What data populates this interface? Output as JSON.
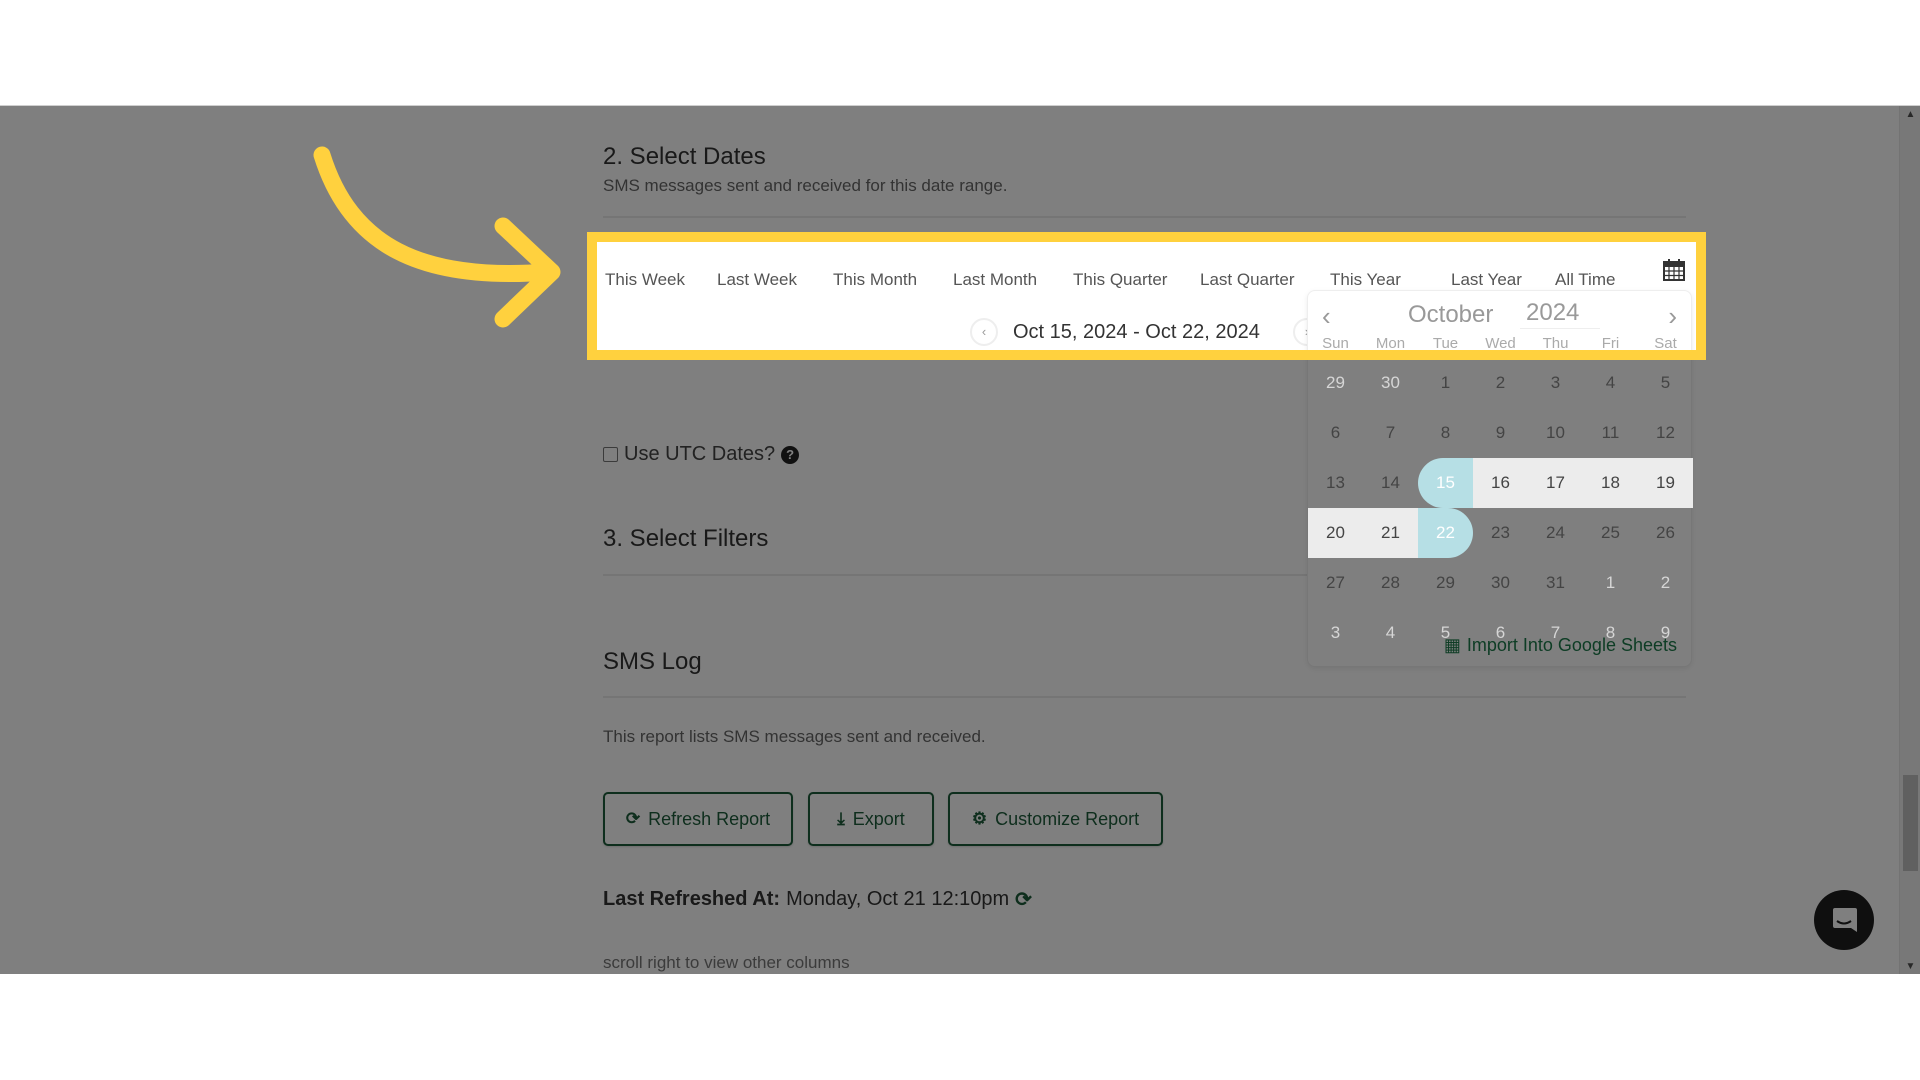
{
  "select_dates": {
    "heading": "2. Select Dates",
    "description": "SMS messages sent and received for this date range.",
    "presets": [
      "This Week",
      "Last Week",
      "This Month",
      "Last Month",
      "This Quarter",
      "Last Quarter",
      "This Year",
      "Last Year",
      "All Time"
    ],
    "range_label": "Oct 15, 2024 - Oct 22, 2024",
    "prev_label": "‹",
    "next_label": "›",
    "utc_label": "Use UTC Dates?",
    "utc_checked": false
  },
  "calendar": {
    "month": "October",
    "year": "2024",
    "prev": "‹",
    "next": "›",
    "weekdays": [
      "Sun",
      "Mon",
      "Tue",
      "Wed",
      "Thu",
      "Fri",
      "Sat"
    ],
    "weeks": [
      [
        "29",
        "30",
        "1",
        "2",
        "3",
        "4",
        "5"
      ],
      [
        "6",
        "7",
        "8",
        "9",
        "10",
        "11",
        "12"
      ],
      [
        "13",
        "14",
        "15",
        "16",
        "17",
        "18",
        "19"
      ],
      [
        "20",
        "21",
        "22",
        "23",
        "24",
        "25",
        "26"
      ],
      [
        "27",
        "28",
        "29",
        "30",
        "31",
        "1",
        "2"
      ],
      [
        "3",
        "4",
        "5",
        "6",
        "7",
        "8",
        "9"
      ]
    ],
    "range_start": "15",
    "range_end": "22",
    "import_label": "Import Into Google Sheets",
    "selected_color": "#b6dfe5"
  },
  "select_filters": {
    "heading": "3. Select Filters"
  },
  "report": {
    "title": "SMS Log",
    "description": "This report lists SMS messages sent and received.",
    "buttons": {
      "refresh": "Refresh Report",
      "export": "Export",
      "customize": "Customize Report"
    },
    "last_refreshed_label": "Last Refreshed At:",
    "last_refreshed_value": "Monday, Oct 21 12:10pm",
    "scroll_hint": "scroll right to view other columns"
  },
  "colors": {
    "highlight": "#ffd13e",
    "brand_green": "#1d5c3a"
  }
}
